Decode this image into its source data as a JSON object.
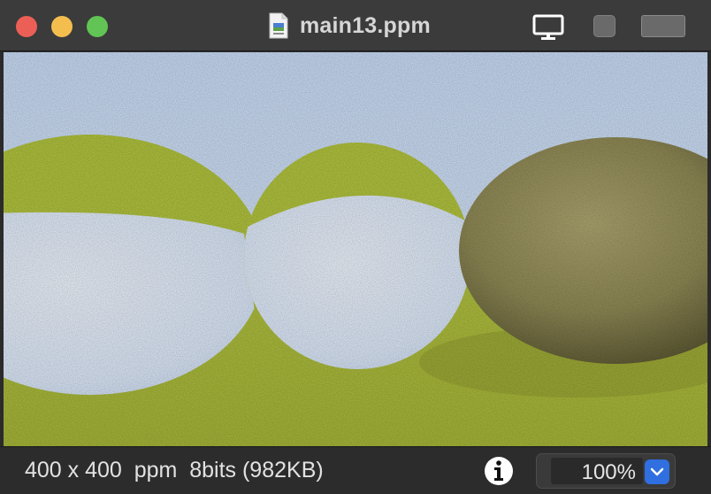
{
  "window": {
    "title": "main13.ppm",
    "file_icon": "ppm-file-icon"
  },
  "toolbar": {
    "display_icon": "monitor-icon",
    "square_icon": "square-icon",
    "wide_icon": "wide-rectangle-icon"
  },
  "status": {
    "dimensions_format_depth_size": "400 x 400  ppm  8bits (982KB)",
    "info_icon": "info-icon"
  },
  "zoom": {
    "value": "100%",
    "dropdown_icon": "chevron-down-icon"
  },
  "colors": {
    "titlebar": "#3b3b3b",
    "statusbar": "#2c2c2c",
    "close": "#ec5f57",
    "minimize": "#f4be4f",
    "maximize": "#61c454",
    "accent": "#2f6fe0"
  }
}
